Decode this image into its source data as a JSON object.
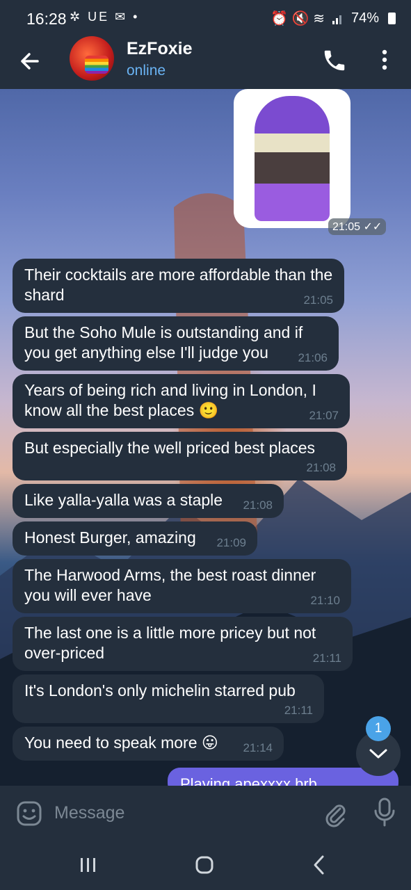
{
  "status_bar": {
    "time": "16:28",
    "left_icons": "✲ UE ✉ •",
    "right_icons": "⏰ 🔇 ≋",
    "battery": "74%"
  },
  "header": {
    "contact_name": "EzFoxie",
    "contact_status": "online"
  },
  "sticker": {
    "time": "21:05 ✓✓"
  },
  "messages": [
    {
      "text": "Their cocktails are more affordable than the shard",
      "time": "21:05"
    },
    {
      "text": "But the Soho Mule is outstanding and if you get anything else I'll judge you",
      "time": "21:06"
    },
    {
      "text": "Years of being rich and living in London, I know all the best places 🙂",
      "time": "21:07"
    },
    {
      "text": "But especially the well priced best places",
      "time": "21:08"
    },
    {
      "text": "Like yalla-yalla was a staple",
      "time": "21:08"
    },
    {
      "text": "Honest Burger, amazing",
      "time": "21:09"
    },
    {
      "text": "The Harwood Arms, the best roast dinner you will ever have",
      "time": "21:10"
    },
    {
      "text": "The last one is a little more pricey but not over-priced",
      "time": "21:11"
    },
    {
      "text": "It's London's only michelin starred pub",
      "time": "21:11"
    },
    {
      "text": "You need to speak more 😛",
      "time": "21:14"
    }
  ],
  "outgoing_partial": "Playing apexxxx brb",
  "unread_count": "1",
  "input": {
    "placeholder": "Message"
  },
  "colors": {
    "bar_bg": "#242f3d",
    "bubble_bg": "#242f3d",
    "accent": "#6ab3f3",
    "outgoing_bg": "#6a62e0",
    "badge": "#4aa3e8"
  }
}
